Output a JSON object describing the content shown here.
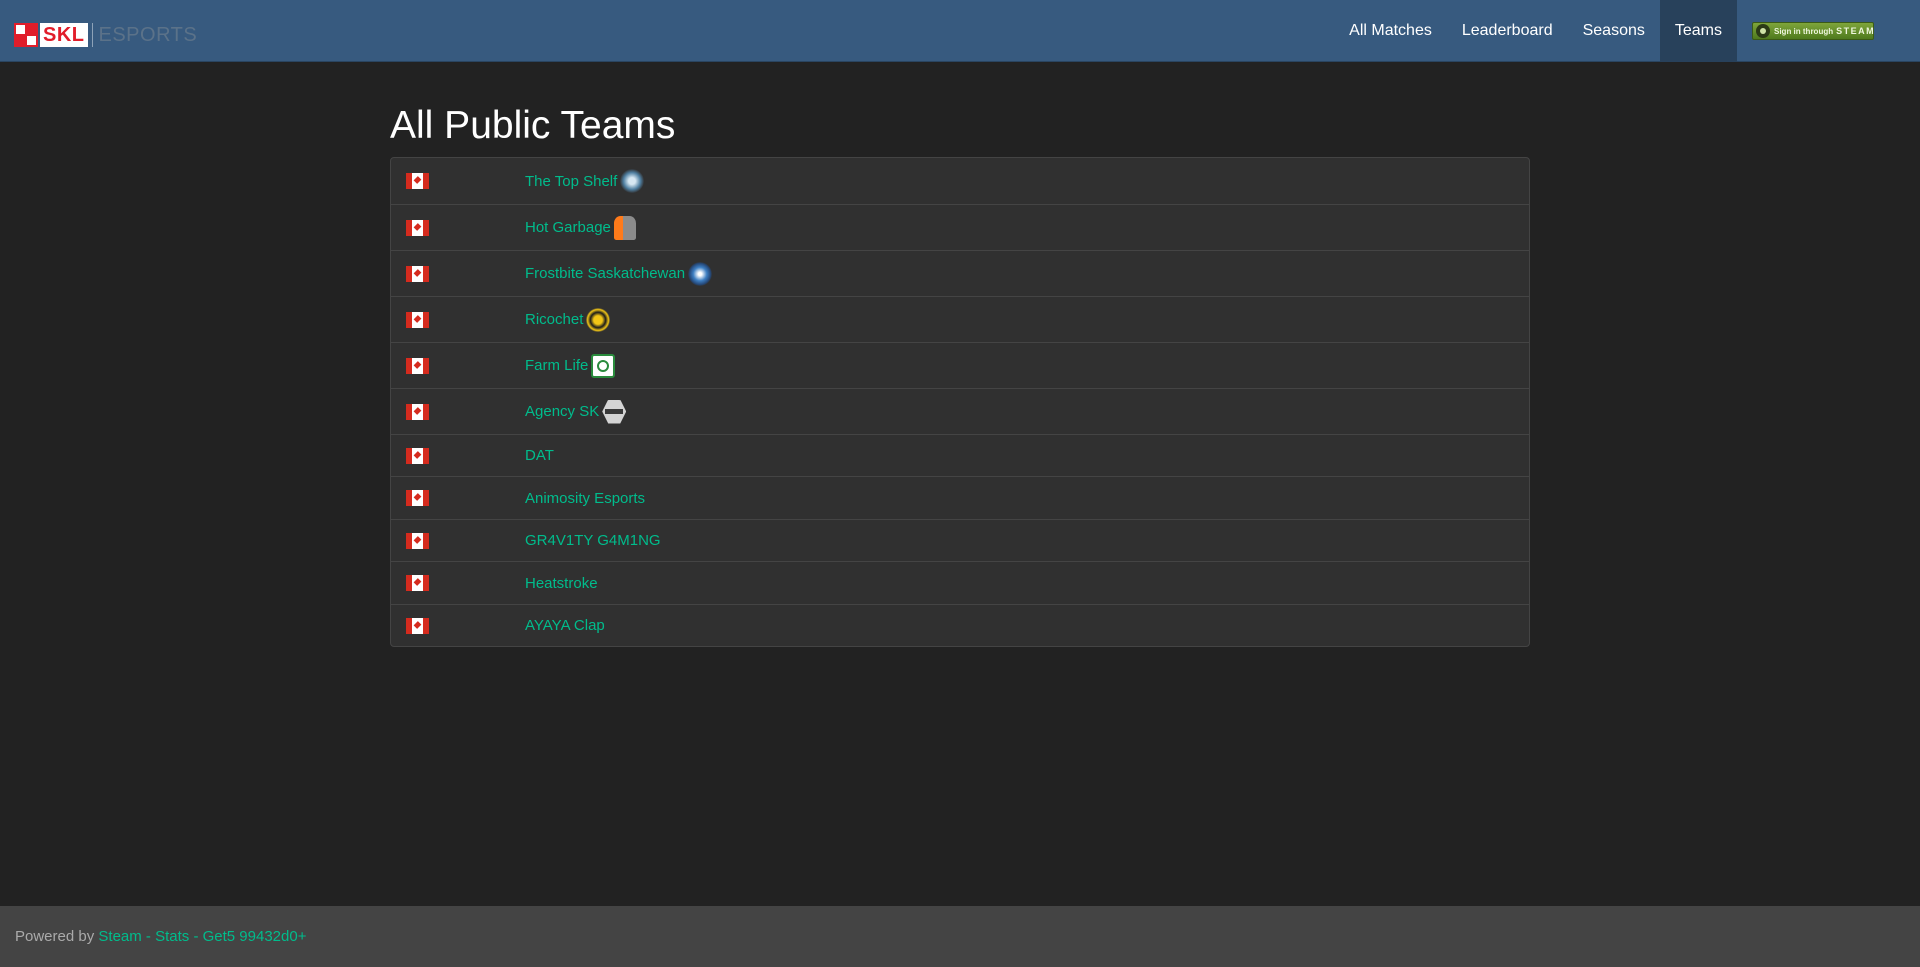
{
  "brand": {
    "logo_text": "SKL",
    "suffix": "ESPORTS"
  },
  "nav": {
    "items": [
      {
        "label": "All Matches"
      },
      {
        "label": "Leaderboard"
      },
      {
        "label": "Seasons"
      },
      {
        "label": "Teams",
        "active": true
      }
    ],
    "steam_button": {
      "prefix": "Sign in through",
      "brand": "STEAM"
    }
  },
  "main": {
    "title": "All Public Teams",
    "teams": [
      {
        "name": "The Top Shelf",
        "country": "Canada",
        "logo": "top-shelf-logo-icon"
      },
      {
        "name": "Hot Garbage",
        "country": "Canada",
        "logo": "hot-garbage-logo-icon"
      },
      {
        "name": "Frostbite Saskatchewan",
        "country": "Canada",
        "logo": "frostbite-logo-icon"
      },
      {
        "name": "Ricochet",
        "country": "Canada",
        "logo": "ricochet-logo-icon"
      },
      {
        "name": "Farm Life",
        "country": "Canada",
        "logo": "farm-life-logo-icon"
      },
      {
        "name": "Agency SK",
        "country": "Canada",
        "logo": "agency-sk-logo-icon"
      },
      {
        "name": "DAT",
        "country": "Canada",
        "logo": null
      },
      {
        "name": "Animosity Esports",
        "country": "Canada",
        "logo": null
      },
      {
        "name": "GR4V1TY G4M1NG",
        "country": "Canada",
        "logo": null
      },
      {
        "name": "Heatstroke",
        "country": "Canada",
        "logo": null
      },
      {
        "name": "AYAYA Clap",
        "country": "Canada",
        "logo": null
      }
    ]
  },
  "footer": {
    "prefix": "Powered by",
    "link_steam": "Steam",
    "sep1": "-",
    "link_stats": "Stats",
    "sep2": "-",
    "link_get5": "Get5 99432d0+"
  },
  "colors": {
    "navbar": "#375a7f",
    "background": "#222222",
    "link": "#00bc8c",
    "footer": "#444444"
  }
}
